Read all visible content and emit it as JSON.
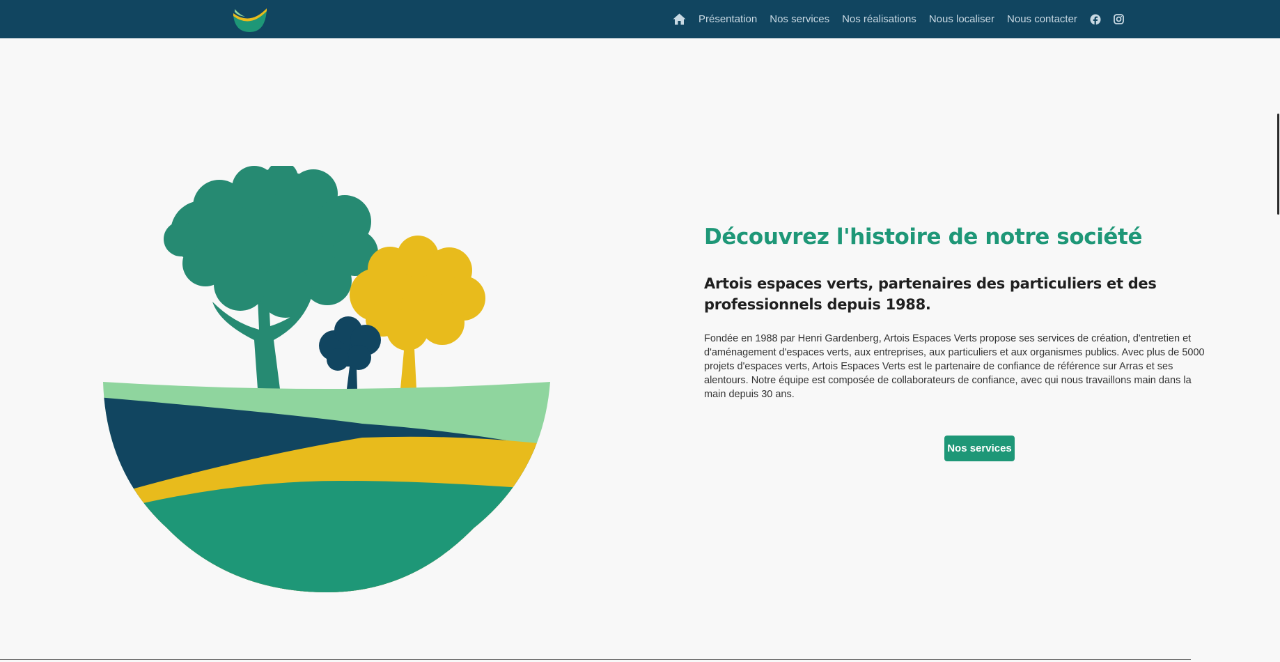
{
  "nav": {
    "items": [
      {
        "label": "Présentation"
      },
      {
        "label": "Nos services"
      },
      {
        "label": "Nos réalisations"
      },
      {
        "label": "Nous localiser"
      },
      {
        "label": "Nous contacter"
      }
    ],
    "icons": [
      "home-icon",
      "facebook-icon",
      "instagram-icon"
    ]
  },
  "hero": {
    "title": "Découvrez l'histoire de notre société",
    "subtitle": "Artois espaces verts, partenaires des particuliers et des professionnels depuis 1988.",
    "body": "Fondée en 1988 par Henri Gardenberg, Artois Espaces Verts propose ses services de création, d'entretien et d'aménagement d'espaces verts, aux entreprises, aux particuliers et aux organismes publics. Avec plus de 5000 projets d'espaces verts, Artois Espaces Verts est le partenaire de confiance de référence sur Arras et ses alentours. Notre équipe est composée de collaborateurs de confiance, avec qui nous travaillons main dans la main depuis 30 ans.",
    "cta_label": "Nos services"
  },
  "colors": {
    "nav_bg": "#114560",
    "accent_green": "#1e9777",
    "light_green": "#8fd59e",
    "yellow": "#e8bb1c",
    "tree_green": "#268a72",
    "navy": "#114560"
  }
}
